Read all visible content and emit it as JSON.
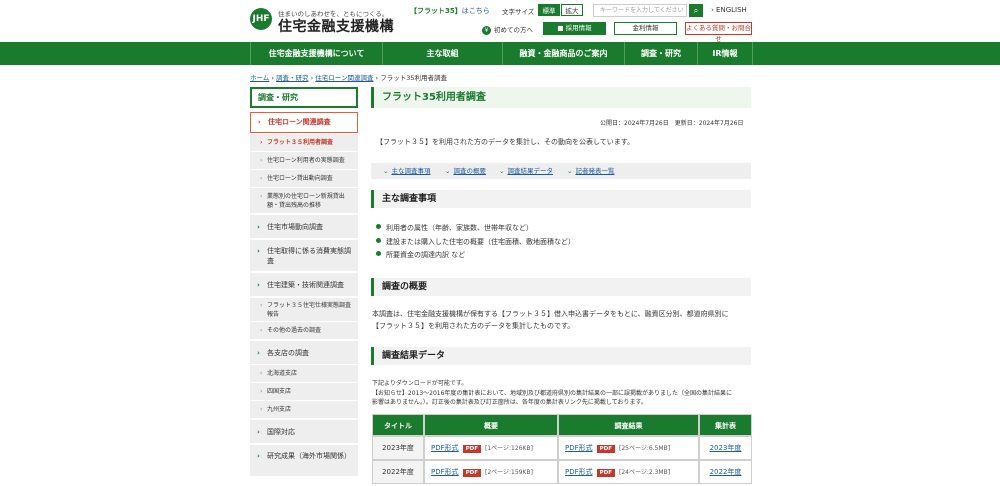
{
  "header": {
    "logo_mark": "JHF",
    "tagline": "住まいのしあわせを、ともにつくる。",
    "org_name": "住宅金融支援機構",
    "flat35_prefix": "【フラット35】",
    "flat35_link": "はこちら",
    "font_size_label": "文字サイズ",
    "font_std": "標準",
    "font_big": "拡大",
    "search_placeholder": "キーワードを入力してください",
    "english": "ENGLISH",
    "first_time": "初めての方へ",
    "recruit": "採用情報",
    "rates": "金利情報",
    "faq": "よくある質問・お問合せ"
  },
  "gnav": [
    "住宅金融支援機構について",
    "主な取組",
    "融資・金融商品のご案内",
    "調査・研究",
    "IR情報"
  ],
  "breadcrumb": {
    "home": "ホーム",
    "research": "調査・研究",
    "loan": "住宅ローン関連調査",
    "current": "フラット35利用者調査",
    "sep": " › "
  },
  "sidebar": {
    "heading": "調査・研究",
    "items": [
      "住宅ローン関連調査",
      "フラット３５利用者調査",
      "住宅ローン利用者の実態調査",
      "住宅ローン貸出動向調査",
      "業態別の住宅ローン新規貸出額・貸出残高の推移",
      "住宅市場動向調査",
      "住宅取得に係る消費実態調査",
      "住宅建築・技術関連調査",
      "フラット３５住宅仕様実態調査報告",
      "その他の過去の調査",
      "各支店の調査",
      "北海道支店",
      "四国支店",
      "九州支店",
      "国際対応",
      "研究成果（海外市場関係）"
    ]
  },
  "main": {
    "title": "フラット35利用者調査",
    "published": "公開日：2024年7月26日",
    "updated": "更新日：2024年7月26日",
    "lead": "【フラット３５】を利用された方のデータを集計し、その動向を公表しています。",
    "anchors": [
      "主な調査事項",
      "調査の概要",
      "調査結果データ",
      "記者発表一覧"
    ],
    "sec1": "主な調査事項",
    "bullets": [
      "利用者の属性（年齢、家族数、世帯年収など）",
      "建設または購入した住宅の概要（住宅面積、敷地面積など）",
      "所要資金の調達内訳 など"
    ],
    "sec2": "調査の概要",
    "overview_1": "本調査は、住宅金融支援機構が保有する【フラット３５】借入申込書データをもとに、融資区分別、都道府県別に",
    "overview_2": "【フラット３５】を利用された方のデータを集計したものです。",
    "sec3": "調査結果データ",
    "note_1": "下記よりダウンロードが可能です。",
    "note_2": "【お知らせ】2013〜2016年度の集計表において、地域別及び都道府県別の集計結果の一部に誤掲載がありました（全国の集計結果に",
    "note_3": "影響はありません。）。訂正後の集計表及び訂正箇所は、各年度の集計表リンク先に掲載しております。"
  },
  "table": {
    "headers": [
      "タイトル",
      "概要",
      "調査結果",
      "集計表"
    ],
    "pdf_label": "PDF形式",
    "pdf_badge": "PDF",
    "rows": [
      {
        "year": "2023年度",
        "summary_size": "[1ページ:126KB]",
        "result_size": "[25ページ:6.5MB]",
        "table_link": "2023年度"
      },
      {
        "year": "2022年度",
        "summary_size": "[2ページ:159KB]",
        "result_size": "[24ページ:2.3MB]",
        "table_link": "2022年度"
      }
    ]
  },
  "colors": {
    "brand_green": "#1a7a2e",
    "accent_red": "#c0392b",
    "link_blue": "#1a5aa0"
  }
}
